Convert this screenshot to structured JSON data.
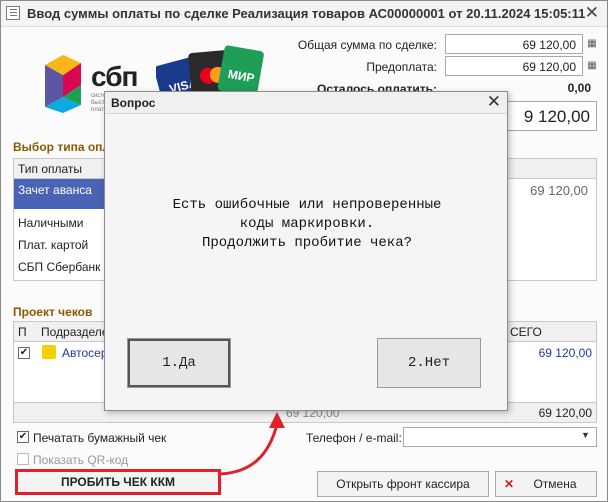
{
  "window": {
    "title": "Ввод суммы оплаты по сделке Реализация товаров АС00000001 от 20.11.2024 15:05:11",
    "close": "✕"
  },
  "logo": {
    "sbp_text": "сбп",
    "sbp_small": "система быстрых платежей"
  },
  "summary": {
    "total_label": "Общая сумма по сделке:",
    "total_value": "69 120,00",
    "prepay_label": "Предоплата:",
    "prepay_value": "69 120,00",
    "remaining_label": "Осталось оплатить:",
    "remaining_value": "0,00",
    "big_value": "9 120,00"
  },
  "payment_type": {
    "section_label": "Выбор типа опл",
    "header": "Тип оплаты",
    "items": [
      "Зачет аванса",
      "Наличными",
      "Плат. картой",
      "СБП Сбербанк"
    ],
    "right_value": "69 120,00"
  },
  "checks": {
    "section_label": "Проект чеков",
    "col_p": "П",
    "col_dept": "Подразделе",
    "col_total": "СЕГО",
    "row_dept": "Автосер",
    "row_total": "69 120,00",
    "footer_total": "69 120,00",
    "footer_hidden": "69 120,00"
  },
  "options": {
    "print_paper": "Печатать бумажный чек",
    "show_qr": "Показать QR-код",
    "phone_label": "Телефон / e-mail:",
    "phone_value": ""
  },
  "buttons": {
    "punch": "ПРОБИТЬ ЧЕК ККМ",
    "front": "Открыть фронт кассира",
    "cancel": "Отмена"
  },
  "dialog": {
    "title": "Вопрос",
    "line1": "Есть ошибочные или непроверенные",
    "line2": "коды маркировки.",
    "line3": "Продолжить пробитие чека?",
    "yes": "1.Да",
    "no": "2.Нет"
  },
  "colors": {
    "accent_red": "#e0202a",
    "selection": "#4a64b5",
    "section": "#8a5a00"
  }
}
